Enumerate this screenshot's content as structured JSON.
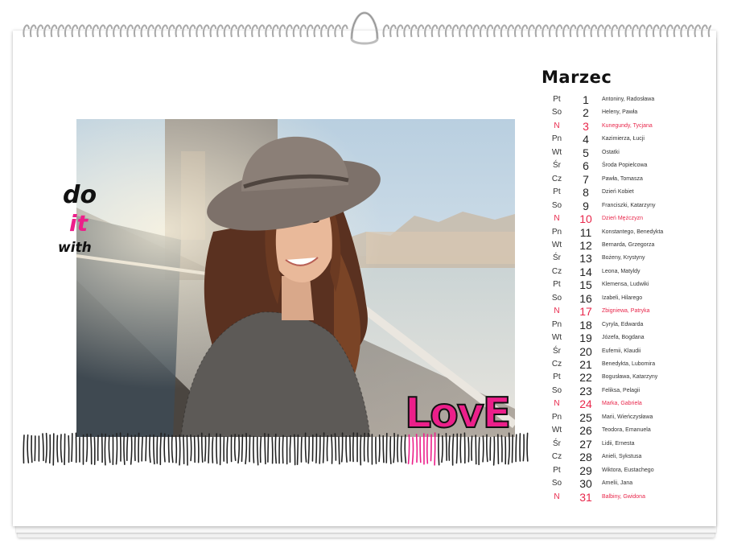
{
  "calendar": {
    "month": "Marzec",
    "slogan": {
      "line1": "do",
      "line2": "it",
      "line3": "with",
      "love": "LovE"
    },
    "colors": {
      "accent": "#e8274b",
      "pink": "#ec1f8a",
      "text": "#222222"
    },
    "days": [
      {
        "day": "Pt",
        "num": "1",
        "names": "Antoniny, Radosława",
        "holiday": false
      },
      {
        "day": "So",
        "num": "2",
        "names": "Heleny, Pawła",
        "holiday": false
      },
      {
        "day": "N",
        "num": "3",
        "names": "Kunegundy, Tycjana",
        "holiday": true
      },
      {
        "day": "Pn",
        "num": "4",
        "names": "Kazimierza, Łucji",
        "holiday": false
      },
      {
        "day": "Wt",
        "num": "5",
        "names": "Ostatki",
        "holiday": false
      },
      {
        "day": "Śr",
        "num": "6",
        "names": "Środa Popielcowa",
        "holiday": false
      },
      {
        "day": "Cz",
        "num": "7",
        "names": "Pawła, Tomasza",
        "holiday": false
      },
      {
        "day": "Pt",
        "num": "8",
        "names": "Dzień Kobiet",
        "holiday": false
      },
      {
        "day": "So",
        "num": "9",
        "names": "Franciszki, Katarzyny",
        "holiday": false
      },
      {
        "day": "N",
        "num": "10",
        "names": "Dzień Mężczyzn",
        "holiday": true
      },
      {
        "day": "Pn",
        "num": "11",
        "names": "Konstantego, Benedykta",
        "holiday": false
      },
      {
        "day": "Wt",
        "num": "12",
        "names": "Bernarda, Grzegorza",
        "holiday": false
      },
      {
        "day": "Śr",
        "num": "13",
        "names": "Bożeny, Krystyny",
        "holiday": false
      },
      {
        "day": "Cz",
        "num": "14",
        "names": "Leona, Matyldy",
        "holiday": false
      },
      {
        "day": "Pt",
        "num": "15",
        "names": "Klemensa, Ludwiki",
        "holiday": false
      },
      {
        "day": "So",
        "num": "16",
        "names": "Izabeli, Hilarego",
        "holiday": false
      },
      {
        "day": "N",
        "num": "17",
        "names": "Zbigniewa, Patryka",
        "holiday": true
      },
      {
        "day": "Pn",
        "num": "18",
        "names": "Cyryla, Edwarda",
        "holiday": false
      },
      {
        "day": "Wt",
        "num": "19",
        "names": "Józefa, Bogdana",
        "holiday": false
      },
      {
        "day": "Śr",
        "num": "20",
        "names": "Eufemii, Klaudii",
        "holiday": false
      },
      {
        "day": "Cz",
        "num": "21",
        "names": "Benedykta, Lubomira",
        "holiday": false
      },
      {
        "day": "Pt",
        "num": "22",
        "names": "Bogusława, Katarzyny",
        "holiday": false
      },
      {
        "day": "So",
        "num": "23",
        "names": "Feliksa, Pelagii",
        "holiday": false
      },
      {
        "day": "N",
        "num": "24",
        "names": "Marka, Gabriela",
        "holiday": true
      },
      {
        "day": "Pn",
        "num": "25",
        "names": "Marii, Wieńczysława",
        "holiday": false
      },
      {
        "day": "Wt",
        "num": "26",
        "names": "Teodora, Emanuela",
        "holiday": false
      },
      {
        "day": "Śr",
        "num": "27",
        "names": "Lidii, Ernesta",
        "holiday": false
      },
      {
        "day": "Cz",
        "num": "28",
        "names": "Anieli, Sykstusa",
        "holiday": false
      },
      {
        "day": "Pt",
        "num": "29",
        "names": "Wiktora, Eustachego",
        "holiday": false
      },
      {
        "day": "So",
        "num": "30",
        "names": "Amelii, Jana",
        "holiday": false
      },
      {
        "day": "N",
        "num": "31",
        "names": "Balbiny, Gwidona",
        "holiday": true
      }
    ]
  }
}
